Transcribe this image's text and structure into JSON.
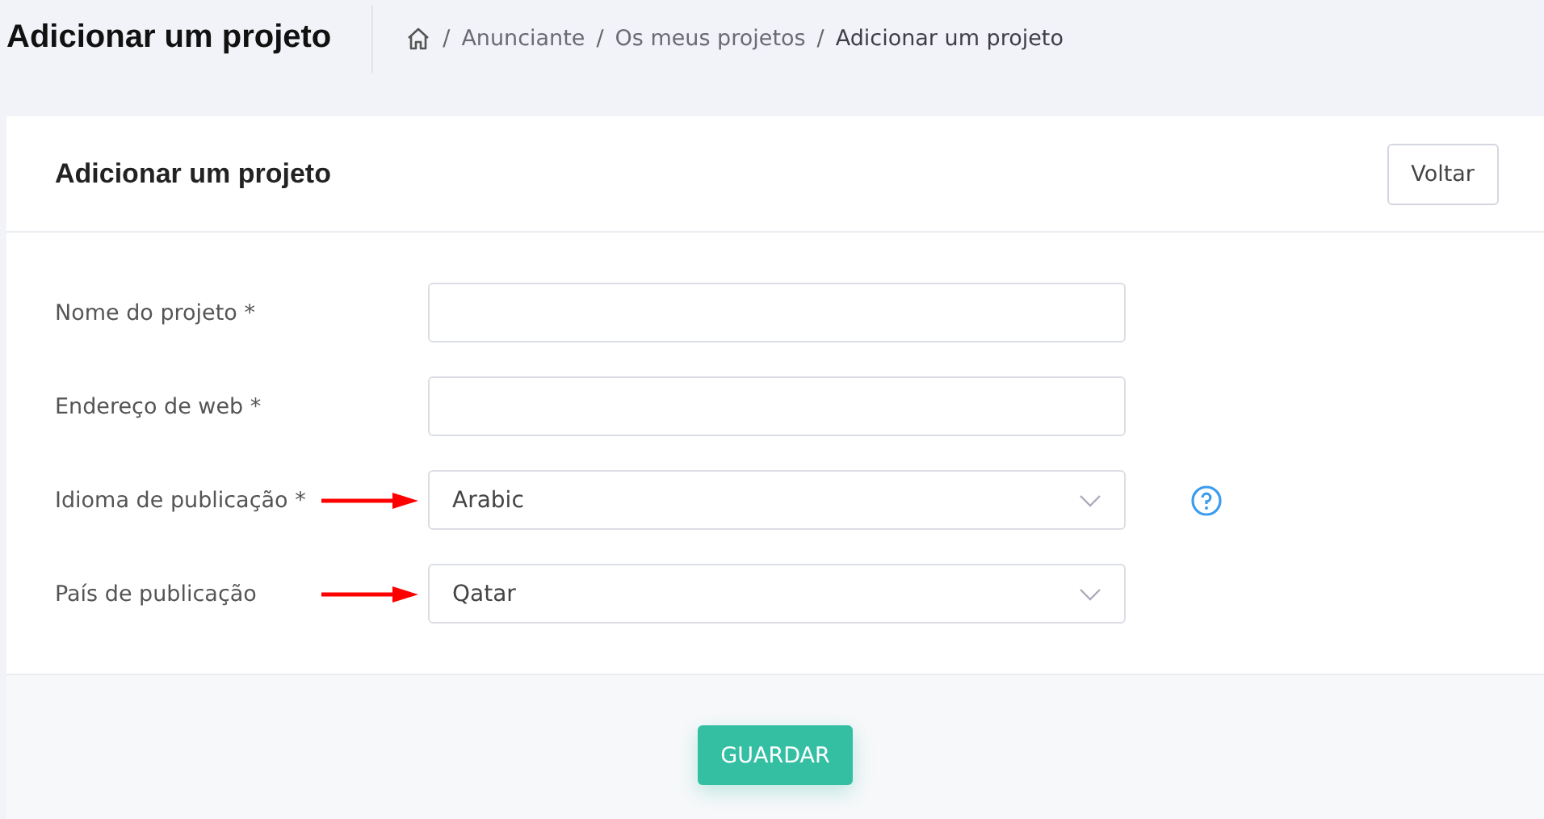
{
  "page_title": "Adicionar um projeto",
  "breadcrumb": [
    {
      "separator": "/",
      "text": "Anunciante"
    },
    {
      "separator": "/",
      "text": "Os meus projetos"
    },
    {
      "separator": "/",
      "text": "Adicionar um projeto"
    }
  ],
  "card": {
    "title": "Adicionar um projeto",
    "back_button": "Voltar"
  },
  "fields": [
    {
      "kind": "text",
      "label": "Nome do projeto *",
      "arrow": false,
      "help": false
    },
    {
      "kind": "text",
      "label": "Endereço de web *",
      "arrow": false,
      "help": false
    },
    {
      "kind": "select",
      "label": "Idioma de publicação *",
      "value": "Arabic",
      "arrow": true,
      "help": true
    },
    {
      "kind": "select",
      "label": "País de publicação",
      "value": "Qatar",
      "arrow": true,
      "help": false
    }
  ],
  "save_button": "GUARDAR"
}
